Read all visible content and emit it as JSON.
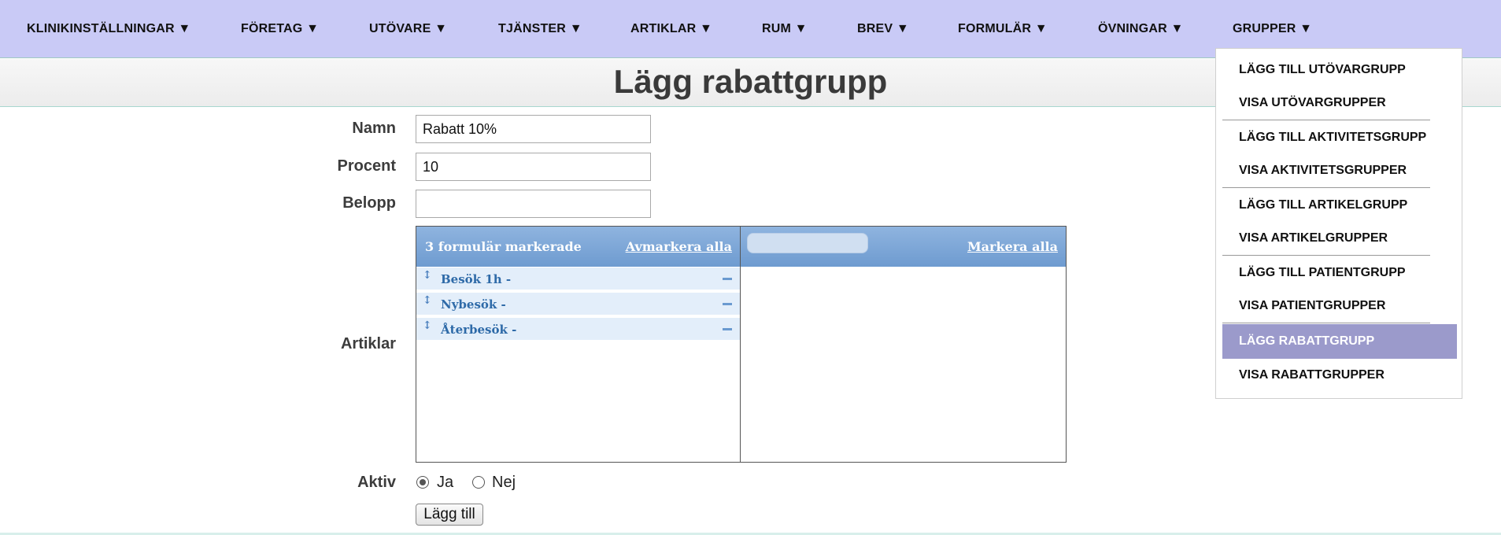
{
  "nav": {
    "items": [
      "KLINIKINSTÄLLNINGAR ▼",
      "FÖRETAG ▼",
      "UTÖVARE ▼",
      "TJÄNSTER ▼",
      "ARTIKLAR ▼",
      "RUM ▼",
      "BREV ▼",
      "FORMULÄR ▼",
      "ÖVNINGAR ▼",
      "GRUPPER ▼"
    ]
  },
  "page": {
    "title": "Lägg rabattgrupp"
  },
  "form": {
    "name_label": "Namn",
    "name_value": "Rabatt 10%",
    "percent_label": "Procent",
    "percent_value": "10",
    "amount_label": "Belopp",
    "amount_value": "",
    "articles_label": "Artiklar",
    "active_label": "Aktiv",
    "active_yes": "Ja",
    "active_no": "Nej",
    "active_selected": "Ja",
    "submit_label": "Lägg till"
  },
  "multiselect": {
    "selected_count": "3 formulär markerade",
    "deselect_all": "Avmarkera alla",
    "select_all": "Markera alla",
    "selected_items": [
      "Besök 1h -",
      "Nybesök -",
      "Återbesök -"
    ]
  },
  "dropdown": {
    "items": [
      "LÄGG TILL UTÖVARGRUPP",
      "VISA UTÖVARGRUPPER",
      "LÄGG TILL AKTIVITETSGRUPP",
      "VISA AKTIVITETSGRUPPER",
      "LÄGG TILL ARTIKELGRUPP",
      "VISA ARTIKELGRUPPER",
      "LÄGG TILL PATIENTGRUPP",
      "VISA PATIENTGRUPPER",
      "LÄGG RABATTGRUPP",
      "VISA RABATTGRUPPER"
    ],
    "active_item": "LÄGG RABATTGRUPP"
  },
  "colors": {
    "nav_bg": "#c9caf6",
    "header_blue": "#7ea8d8",
    "item_text": "#2e6aa8",
    "active_menu_bg": "#9b9acb"
  }
}
